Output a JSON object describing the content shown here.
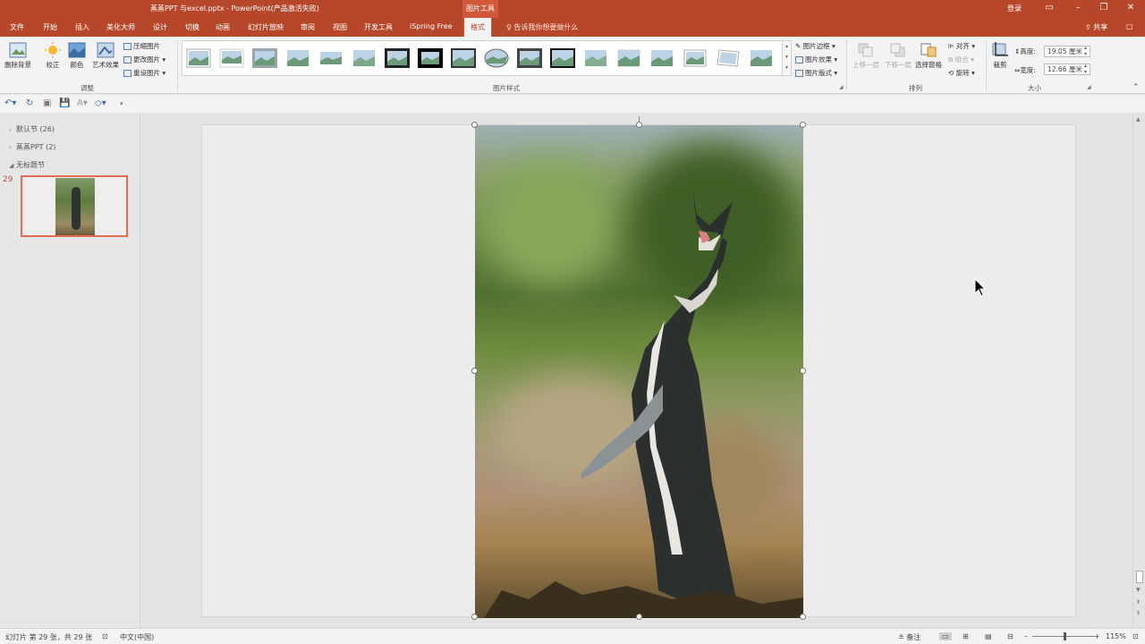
{
  "title_bar": {
    "doc_title": "蒸蒸PPT 与excel.pptx  -  PowerPoint(产品激活失败)",
    "context_tab_group": "图片工具",
    "login": "登录",
    "minimize": "▭",
    "restore": "❐",
    "close": "✕"
  },
  "tabs": [
    {
      "label": "文件"
    },
    {
      "label": "开始"
    },
    {
      "label": "插入"
    },
    {
      "label": "美化大师"
    },
    {
      "label": "设计"
    },
    {
      "label": "切换"
    },
    {
      "label": "动画"
    },
    {
      "label": "幻灯片放映"
    },
    {
      "label": "审阅"
    },
    {
      "label": "视图"
    },
    {
      "label": "开发工具"
    },
    {
      "label": "iSpring Free"
    },
    {
      "label": "格式"
    }
  ],
  "tell_me": "告诉我你想要做什么",
  "share": "共享",
  "ribbon": {
    "adjust": {
      "remove_bg": "删除背景",
      "correct": "校正",
      "color": "颜色",
      "art_effects": "艺术效果",
      "compress": "压缩图片",
      "change": "更改图片",
      "reset": "重设图片",
      "group_label": "调整"
    },
    "styles": {
      "group_label": "图片样式",
      "border": "图片边框",
      "effects": "图片效果",
      "layout": "图片版式"
    },
    "arrange": {
      "forward": "上移一层",
      "backward": "下移一层",
      "selection_pane": "选择窗格",
      "align": "对齐",
      "group": "组合",
      "rotate": "旋转",
      "group_label": "排列"
    },
    "size": {
      "crop": "裁剪",
      "height_label": "高度:",
      "height_value": "19.05 厘米",
      "width_label": "宽度:",
      "width_value": "12.66 厘米",
      "group_label": "大小"
    }
  },
  "sections": [
    {
      "label": "默认节 (26)"
    },
    {
      "label": "蒸蒸PPT (2)"
    },
    {
      "label": "无标题节"
    }
  ],
  "slide_number": "29",
  "status": {
    "slide_info": "幻灯片 第 29 张，共 29 张",
    "language": "中文(中国)",
    "notes": "备注",
    "zoom": "115%"
  },
  "colors": {
    "accent": "#b7472a",
    "selected_thumb_border": "#e46c55"
  }
}
